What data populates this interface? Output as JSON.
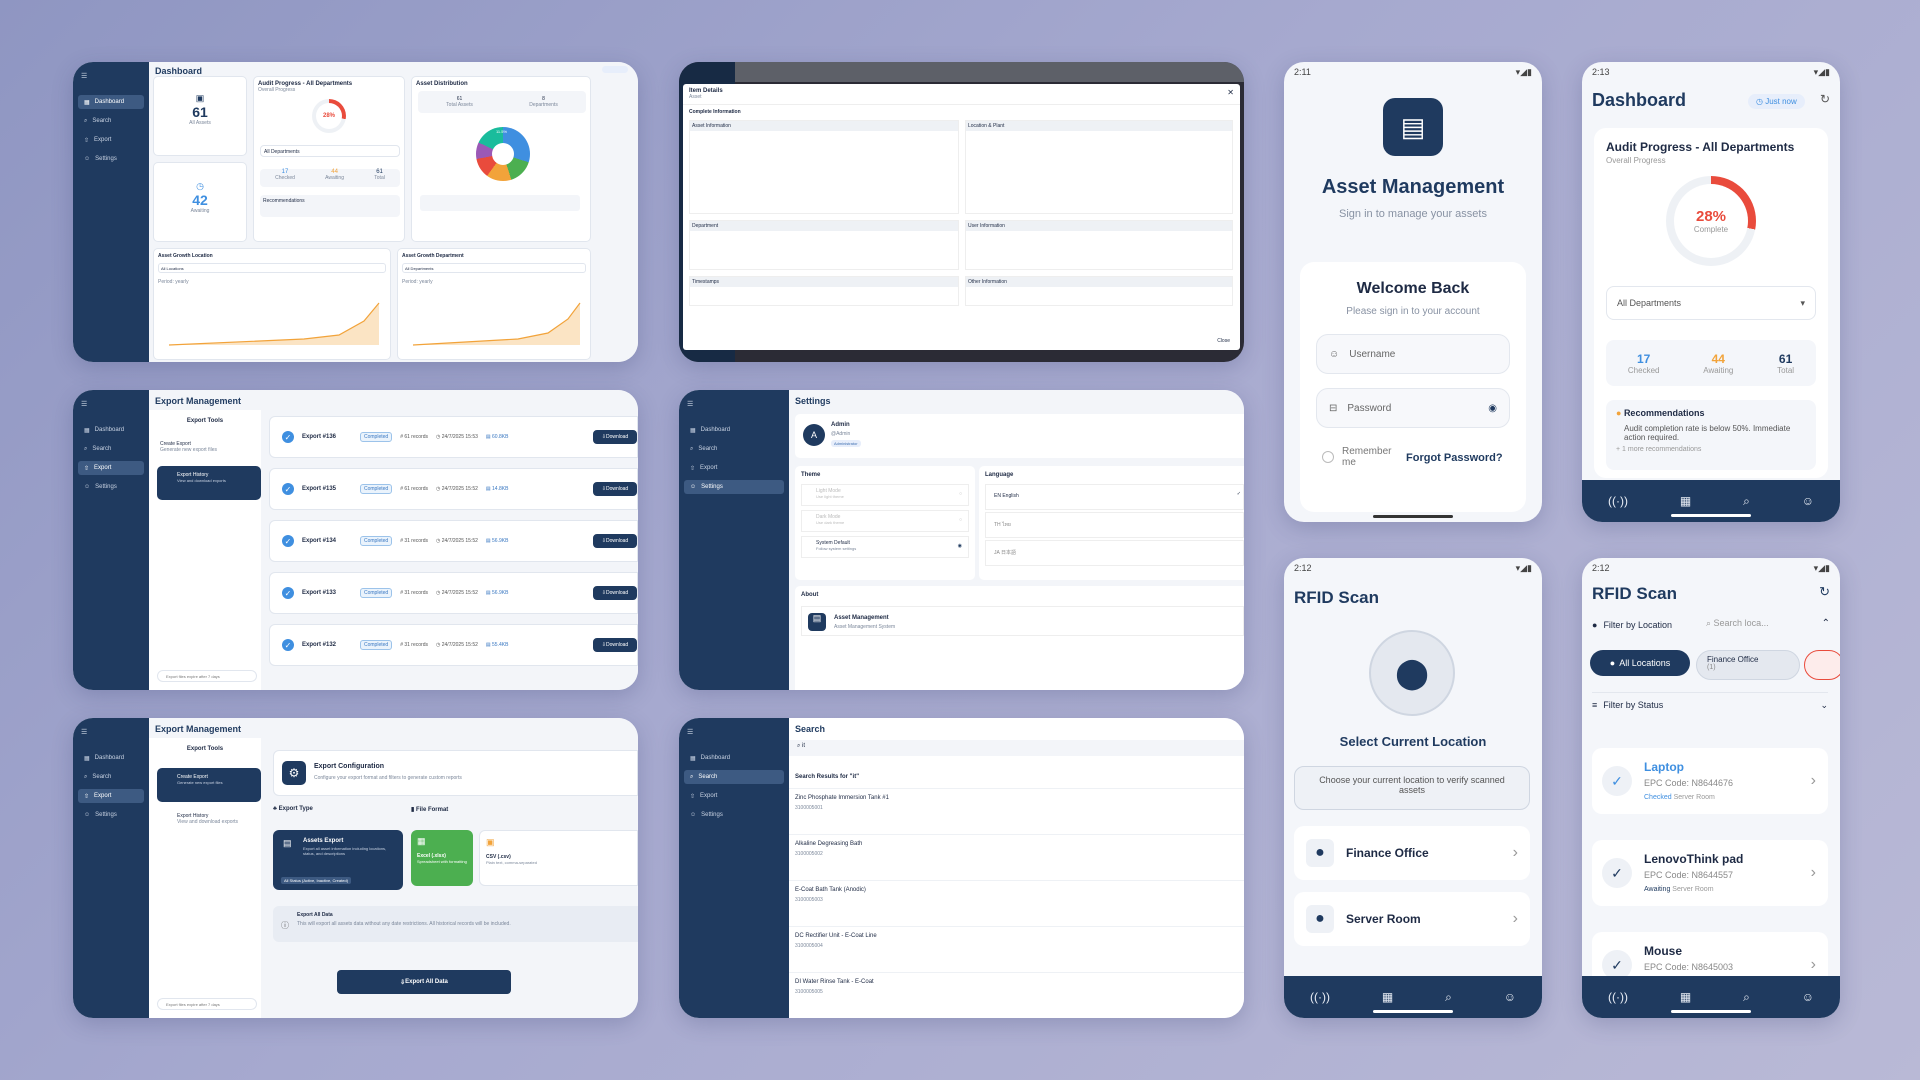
{
  "colors": {
    "navy": "#1f3a5f",
    "accent": "#e94b3c",
    "blue": "#3f8fe0",
    "green": "#4caf50",
    "orange": "#f2a33a"
  },
  "c1": {
    "title": "Dashboard",
    "nav": [
      "Dashboard",
      "Search",
      "Export",
      "Settings"
    ],
    "stat1": "61",
    "stat1_lbl": "All Assets",
    "stat2": "42",
    "stat2_lbl": "Awaiting",
    "audit_title": "Audit Progress - All Departments",
    "audit_sub": "Overall Progress",
    "audit_pct": "28%",
    "audit_select": "All Departments",
    "mini_stats": [
      {
        "v": "17",
        "l": "Checked"
      },
      {
        "v": "44",
        "l": "Awaiting"
      },
      {
        "v": "61",
        "l": "Total"
      }
    ],
    "recs": "Recommendations",
    "dist_title": "Asset Distribution",
    "dist_boxes": [
      {
        "v": "61",
        "l": "Total Assets"
      },
      {
        "v": "8",
        "l": "Departments"
      }
    ],
    "dist_pct": "11.5%",
    "growth_loc": "Asset Growth Location",
    "growth_dep": "Asset Growth Department",
    "all_locations": "All Locations",
    "all_departments": "All Departments",
    "period": "Period: yearly"
  },
  "c2": {
    "title": "Item Details",
    "sub": "Asset",
    "section": "Complete Information",
    "groups": [
      "Asset Information",
      "Location & Plant",
      "Department",
      "User Information",
      "Timestamps",
      "Other Information"
    ],
    "close": "Close"
  },
  "login": {
    "time": "2:11",
    "title": "Asset Management",
    "subtitle": "Sign in to manage your assets",
    "welcome": "Welcome Back",
    "welcome_sub": "Please sign in to your account",
    "username": "Username",
    "password": "Password",
    "remember": "Remember me",
    "forgot": "Forgot Password?"
  },
  "mdash": {
    "time": "2:13",
    "title": "Dashboard",
    "badge": "Just now",
    "card_title": "Audit Progress - All Departments",
    "card_sub": "Overall Progress",
    "pct": "28%",
    "pct_lbl": "Complete",
    "select": "All Departments",
    "stats": [
      {
        "v": "17",
        "l": "Checked",
        "c": "#3f8fe0"
      },
      {
        "v": "44",
        "l": "Awaiting",
        "c": "#f2a33a"
      },
      {
        "v": "61",
        "l": "Total",
        "c": "#1f3a5f"
      }
    ],
    "rec_title": "Recommendations",
    "rec_text": "Audit completion rate is below 50%. Immediate action required.",
    "rec_more": "+ 1 more recommendations"
  },
  "export1": {
    "title": "Export Management",
    "tools": "Export Tools",
    "create": "Create Export",
    "create_sub": "Generate new export files",
    "history": "Export History",
    "history_sub": "View and download exports",
    "footer": "Export files expire after 7 days",
    "rows": [
      {
        "name": "Export #136",
        "status": "Completed",
        "records": "61 records",
        "date": "24/7/2025 15:53",
        "size": "60.8KB",
        "btn": "Download"
      },
      {
        "name": "Export #135",
        "status": "Completed",
        "records": "61 records",
        "date": "24/7/2025 15:52",
        "size": "14.8KB",
        "btn": "Download"
      },
      {
        "name": "Export #134",
        "status": "Completed",
        "records": "31 records",
        "date": "24/7/2025 15:52",
        "size": "56.9KB",
        "btn": "Download"
      },
      {
        "name": "Export #133",
        "status": "Completed",
        "records": "31 records",
        "date": "24/7/2025 15:52",
        "size": "56.9KB",
        "btn": "Download"
      },
      {
        "name": "Export #132",
        "status": "Completed",
        "records": "31 records",
        "date": "24/7/2025 15:52",
        "size": "55.4KB",
        "btn": "Download"
      }
    ]
  },
  "settings": {
    "title": "Settings",
    "user": "Admin",
    "user_sub": "@Admin",
    "role": "Administrator",
    "theme": "Theme",
    "themes": [
      {
        "n": "Light Mode",
        "s": "Use light theme"
      },
      {
        "n": "Dark Mode",
        "s": "Use dark theme"
      },
      {
        "n": "System Default",
        "s": "Follow system settings"
      }
    ],
    "language": "Language",
    "langs": [
      {
        "c": "EN",
        "n": "English"
      },
      {
        "c": "TH",
        "n": "ไทย"
      },
      {
        "c": "JA",
        "n": "日本語"
      }
    ],
    "about": "About",
    "about_app": "Asset Management",
    "about_sub": "Asset Management System"
  },
  "rfid": {
    "time": "2:12",
    "title": "RFID Scan",
    "select": "Select Current Location",
    "hint": "Choose your current location to verify scanned assets",
    "locs": [
      "Finance Office",
      "Server Room"
    ]
  },
  "rfid2": {
    "time": "2:12",
    "title": "RFID Scan",
    "filter_loc": "Filter by Location",
    "search_ph": "Search loca...",
    "all_locs": "All Locations",
    "finance": "Finance Office",
    "finance_n": "(1)",
    "filter_status": "Filter by Status",
    "items": [
      {
        "name": "Laptop",
        "epc": "EPC Code: N8644676",
        "status": "Checked",
        "loc": "Server Room"
      },
      {
        "name": "LenovoThink pad",
        "epc": "EPC Code: N8644557",
        "status": "Awaiting",
        "loc": "Server Room"
      },
      {
        "name": "Mouse",
        "epc": "EPC Code: N8645003",
        "status": "",
        "loc": ""
      }
    ]
  },
  "export2": {
    "title": "Export Management",
    "tools": "Export Tools",
    "create": "Create Export",
    "create_sub": "Generate new export files",
    "history": "Export History",
    "history_sub": "View and download exports",
    "footer": "Export files expire after 7 days",
    "cfg_title": "Export Configuration",
    "cfg_sub": "Configure your export format and filters to generate custom reports",
    "type": "Export Type",
    "format": "File Format",
    "assets_export": "Assets Export",
    "assets_desc": "Export all asset information including locations, status, and descriptions",
    "assets_tag": "All Status (Active, Inactive, Created)",
    "excel": "Excel (.xlsx)",
    "excel_sub": "Spreadsheet with formatting",
    "csv": "CSV (.csv)",
    "csv_sub": "Plain text, comma-separated",
    "all_title": "Export All Data",
    "all_desc": "This will export all assets data without any date restrictions. All historical records will be included.",
    "btn": "Export All Data"
  },
  "search": {
    "title": "Search",
    "query": "it",
    "results_for": "Search Results for \"it\"",
    "results": [
      {
        "n": "Zinc Phosphate Immersion Tank #1",
        "c": "3100005001"
      },
      {
        "n": "Alkaline Degreasing Bath",
        "c": "3100005002"
      },
      {
        "n": "E-Coat Bath Tank (Anodic)",
        "c": "3100005003"
      },
      {
        "n": "DC Rectifier Unit - E-Coat Line",
        "c": "3100005004"
      },
      {
        "n": "DI Water Rinse Tank - E-Coat",
        "c": "3100005005"
      }
    ]
  }
}
